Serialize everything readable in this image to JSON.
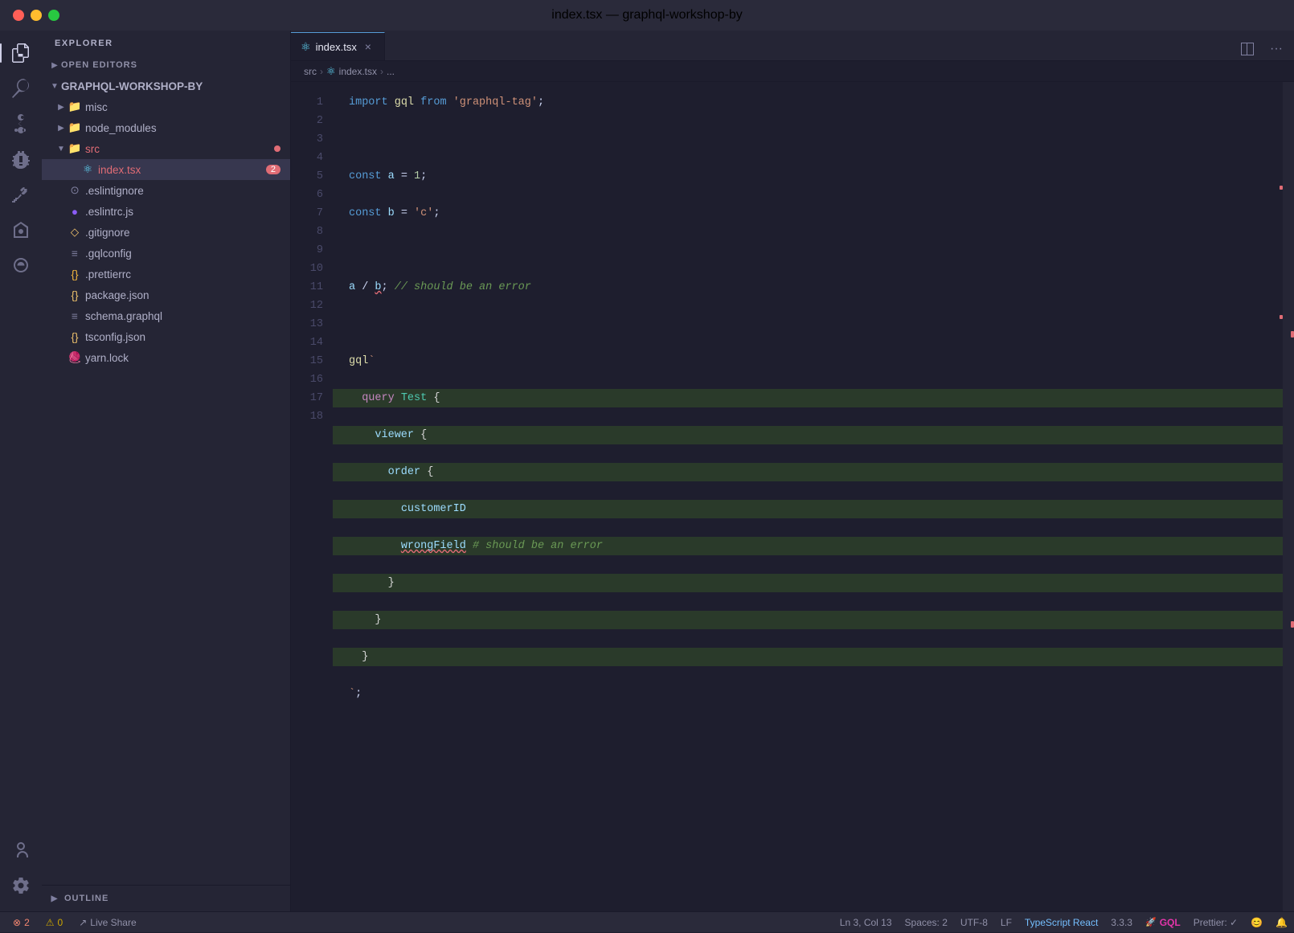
{
  "titlebar": {
    "title": "index.tsx — graphql-workshop-by"
  },
  "activity_bar": {
    "icons": [
      {
        "name": "explorer-icon",
        "symbol": "⎘",
        "active": true
      },
      {
        "name": "search-icon",
        "symbol": "🔍",
        "active": false
      },
      {
        "name": "source-control-icon",
        "symbol": "⑂",
        "active": false
      },
      {
        "name": "debug-icon",
        "symbol": "⊗",
        "active": false
      },
      {
        "name": "extensions-icon",
        "symbol": "⊞",
        "active": false
      },
      {
        "name": "deploy-icon",
        "symbol": "▲",
        "active": false
      },
      {
        "name": "remote-icon",
        "symbol": "⛵",
        "active": false
      }
    ],
    "bottom_icons": [
      {
        "name": "account-icon",
        "symbol": "⊙"
      },
      {
        "name": "settings-icon",
        "symbol": "⚙"
      }
    ]
  },
  "sidebar": {
    "title": "EXPLORER",
    "sections": {
      "open_editors": {
        "label": "OPEN EDITORS",
        "collapsed": true
      },
      "root": {
        "label": "GRAPHQL-WORKSHOP-BY",
        "expanded": true,
        "items": [
          {
            "name": "misc",
            "type": "folder",
            "expanded": false,
            "indent": 1
          },
          {
            "name": "node_modules",
            "type": "folder",
            "expanded": false,
            "indent": 1
          },
          {
            "name": "src",
            "type": "folder-src",
            "expanded": true,
            "indent": 1,
            "dot": true
          },
          {
            "name": "index.tsx",
            "type": "react",
            "indent": 2,
            "active": true,
            "badge": "2"
          },
          {
            "name": ".eslintignore",
            "type": "config",
            "indent": 1
          },
          {
            "name": ".eslintrc.js",
            "type": "eslint",
            "indent": 1
          },
          {
            "name": ".gitignore",
            "type": "git",
            "indent": 1
          },
          {
            "name": ".gqlconfig",
            "type": "config",
            "indent": 1
          },
          {
            "name": ".prettierrc",
            "type": "json-braces",
            "indent": 1
          },
          {
            "name": "package.json",
            "type": "json-braces",
            "indent": 1
          },
          {
            "name": "schema.graphql",
            "type": "config-lines",
            "indent": 1
          },
          {
            "name": "tsconfig.json",
            "type": "json-braces",
            "indent": 1
          },
          {
            "name": "yarn.lock",
            "type": "yarn",
            "indent": 1
          }
        ]
      }
    },
    "outline": {
      "label": "OUTLINE"
    }
  },
  "editor": {
    "tab": {
      "icon": "react",
      "name": "index.tsx",
      "modified": false
    },
    "breadcrumb": [
      "src",
      "index.tsx",
      "..."
    ],
    "lines": [
      {
        "num": 1,
        "content": "import gql from 'graphql-tag';"
      },
      {
        "num": 2,
        "content": ""
      },
      {
        "num": 3,
        "content": "const a = 1;"
      },
      {
        "num": 4,
        "content": "const b = 'c';"
      },
      {
        "num": 5,
        "content": ""
      },
      {
        "num": 6,
        "content": "a / b; // should be an error"
      },
      {
        "num": 7,
        "content": ""
      },
      {
        "num": 8,
        "content": "gql`"
      },
      {
        "num": 9,
        "content": "  query Test {"
      },
      {
        "num": 10,
        "content": "    viewer {"
      },
      {
        "num": 11,
        "content": "      order {"
      },
      {
        "num": 12,
        "content": "        customerID"
      },
      {
        "num": 13,
        "content": "        wrongField # should be an error"
      },
      {
        "num": 14,
        "content": "      }"
      },
      {
        "num": 15,
        "content": "    }"
      },
      {
        "num": 16,
        "content": "  }"
      },
      {
        "num": 17,
        "content": "`;"
      },
      {
        "num": 18,
        "content": ""
      }
    ]
  },
  "status_bar": {
    "errors": "2",
    "warnings": "0",
    "live_share": "Live Share",
    "position": "Ln 3, Col 13",
    "spaces": "Spaces: 2",
    "encoding": "UTF-8",
    "line_ending": "LF",
    "language": "TypeScript React",
    "version": "3.3.3",
    "gql": "GQL",
    "prettier": "Prettier: ✓",
    "emoji": "😊",
    "bell": "🔔"
  }
}
